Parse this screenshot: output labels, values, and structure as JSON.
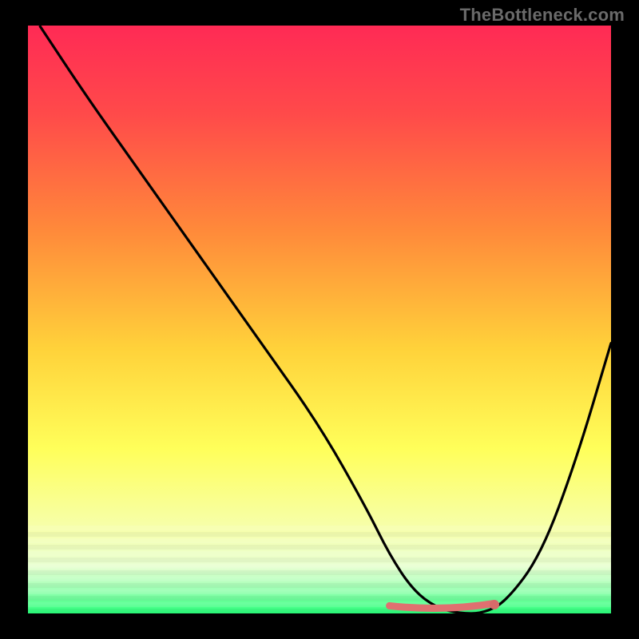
{
  "watermark": "TheBottleneck.com",
  "colors": {
    "bg_black": "#000000",
    "curve": "#000000",
    "highlight_pink": "#e07070",
    "highlight_dot": "#d86a6a"
  },
  "chart_data": {
    "type": "line",
    "title": "",
    "xlabel": "",
    "ylabel": "",
    "xlim": [
      0,
      100
    ],
    "ylim": [
      0,
      100
    ],
    "grid": false,
    "legend": false,
    "background_gradient_stops": [
      {
        "offset": 0.0,
        "color": "#ff2a55"
      },
      {
        "offset": 0.15,
        "color": "#ff4a4a"
      },
      {
        "offset": 0.35,
        "color": "#ff8a3a"
      },
      {
        "offset": 0.55,
        "color": "#ffd23a"
      },
      {
        "offset": 0.72,
        "color": "#ffff5a"
      },
      {
        "offset": 0.86,
        "color": "#f6ffae"
      },
      {
        "offset": 0.92,
        "color": "#e8ffd2"
      },
      {
        "offset": 0.96,
        "color": "#9cffb4"
      },
      {
        "offset": 1.0,
        "color": "#2aff7a"
      }
    ],
    "series": [
      {
        "name": "bottleneck-curve",
        "x": [
          2,
          10,
          20,
          30,
          40,
          50,
          58,
          62,
          66,
          70,
          74,
          78,
          82,
          88,
          94,
          100
        ],
        "y": [
          100,
          88,
          74,
          60,
          46,
          32,
          18,
          10,
          4,
          1,
          0,
          0,
          2,
          10,
          26,
          46
        ]
      }
    ],
    "highlight_segment": {
      "x_start": 62,
      "x_end": 80,
      "y": 0.5
    },
    "highlight_dot": {
      "x": 80,
      "y": 1.5
    }
  }
}
